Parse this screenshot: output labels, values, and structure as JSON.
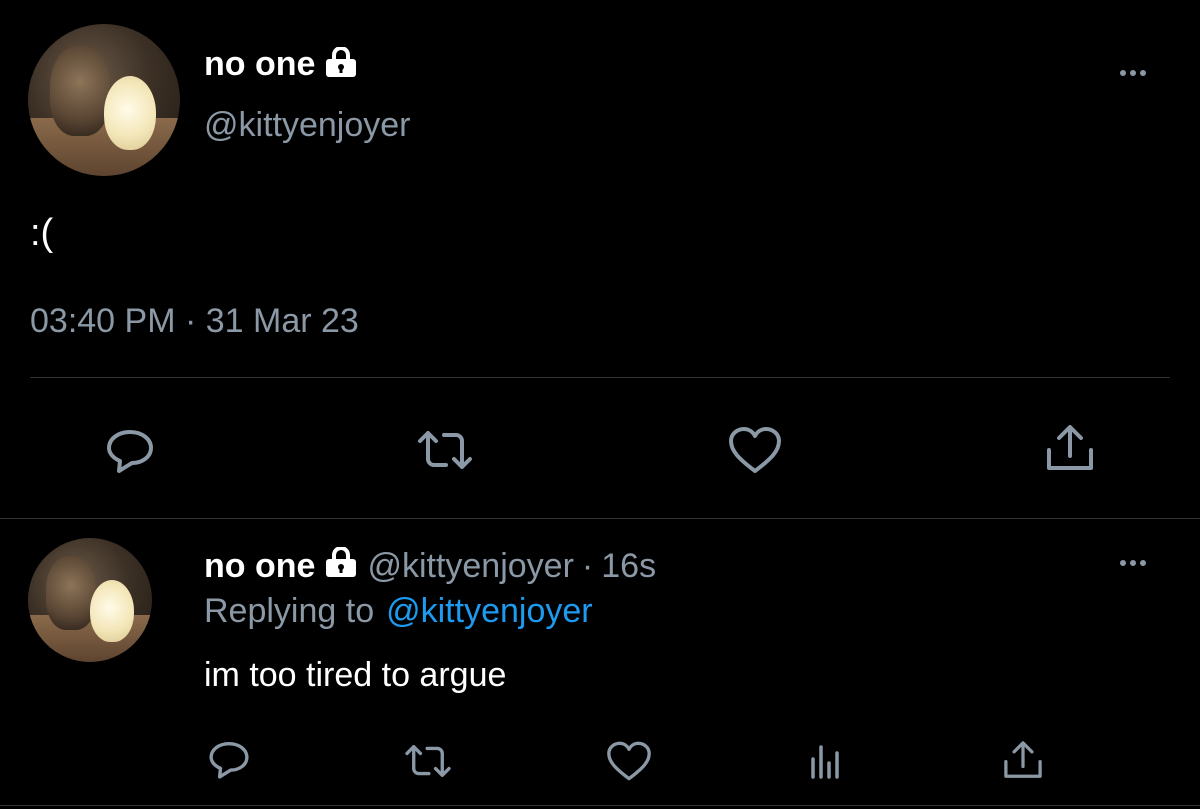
{
  "main_tweet": {
    "display_name": "no one",
    "handle": "@kittyenjoyer",
    "text": ":(",
    "timestamp": "03:40 PM · 31 Mar 23",
    "actions": [
      "reply-icon",
      "retweet-icon",
      "like-icon",
      "share-icon"
    ]
  },
  "reply_tweet": {
    "display_name": "no one",
    "handle": "@kittyenjoyer",
    "separator": "·",
    "age": "16s",
    "replying_to_label": "Replying to",
    "replying_to_handle": "@kittyenjoyer",
    "text": "im too tired to argue",
    "actions": [
      "reply-icon",
      "retweet-icon",
      "like-icon",
      "analytics-icon",
      "share-icon"
    ]
  },
  "colors": {
    "background": "#000000",
    "text": "#ffffff",
    "muted": "#8b98a5",
    "link": "#1d9bf0",
    "divider": "#2f3336"
  }
}
